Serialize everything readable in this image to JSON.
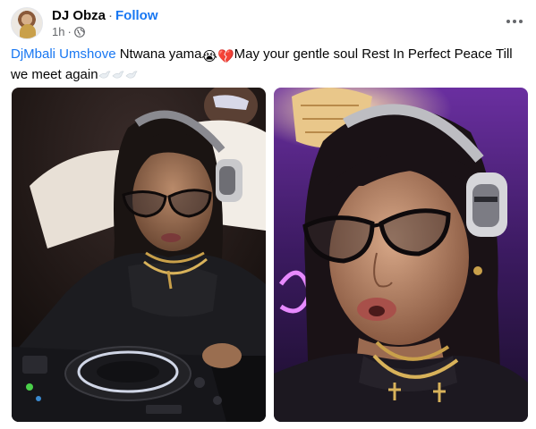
{
  "post": {
    "author": "DJ Obza",
    "separator": "·",
    "follow_label": "Follow",
    "timestamp": "1h",
    "audience_icon": "globe-icon",
    "more_icon": "more-options-icon",
    "mention": "DjMbali Umshove",
    "text_part_1": " Ntwana yama",
    "emoji_crying": "😭",
    "emoji_broken_heart": "💔",
    "text_part_2": "May your gentle soul Rest In Perfect Peace  Till we meet again",
    "trailing_icons": [
      "dove-icon",
      "dove-icon",
      "dove-icon"
    ]
  },
  "photos": [
    {
      "name": "photo-dj-at-decks",
      "description_icon": "photo"
    },
    {
      "name": "photo-dj-closeup",
      "description_icon": "photo"
    }
  ],
  "colors": {
    "link": "#1877f2",
    "secondary_text": "#65676b",
    "primary_text": "#050505"
  }
}
